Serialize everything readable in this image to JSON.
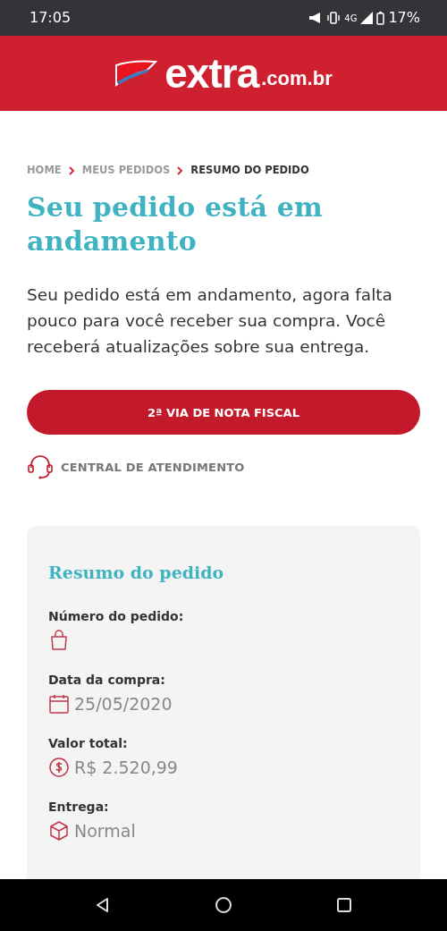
{
  "status_bar": {
    "time": "17:05",
    "network": "4G",
    "battery": "17%"
  },
  "header": {
    "logo_main": "extra",
    "logo_domain": ".com.br"
  },
  "breadcrumb": [
    {
      "label": "HOME",
      "current": false
    },
    {
      "label": "MEUS PEDIDOS",
      "current": false
    },
    {
      "label": "RESUMO DO PEDIDO",
      "current": true
    }
  ],
  "title": "Seu pedido está em andamento",
  "description": "Seu pedido está em andamento, agora falta pouco para você receber sua compra. Você receberá atualizações sobre sua entrega.",
  "invoice_button": "2ª VIA DE NOTA FISCAL",
  "support_link": "CENTRAL DE ATENDIMENTO",
  "summary": {
    "title": "Resumo do pedido",
    "fields": [
      {
        "label": "Número do pedido:",
        "kind": "bag"
      },
      {
        "label": "Data da compra:",
        "kind": "calendar",
        "value": "25/05/2020"
      },
      {
        "label": "Valor total:",
        "kind": "money",
        "value": "R$ 2.520,99"
      },
      {
        "label": "Entrega:",
        "kind": "box",
        "value": "Normal"
      }
    ]
  }
}
